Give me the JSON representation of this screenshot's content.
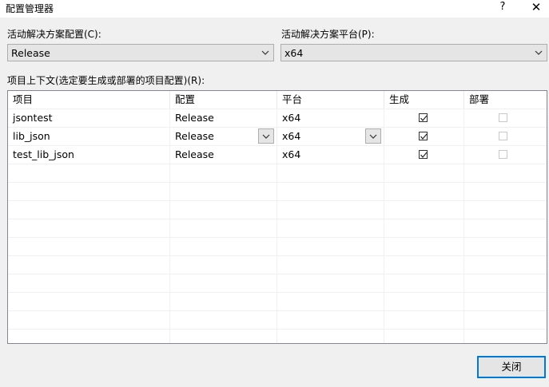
{
  "window": {
    "title": "配置管理器",
    "help_label": "?",
    "close_label": "✕"
  },
  "solution": {
    "config_label": "活动解决方案配置(C):",
    "config_value": "Release",
    "platform_label": "活动解决方案平台(P):",
    "platform_value": "x64"
  },
  "grid": {
    "label": "项目上下文(选定要生成或部署的项目配置)(R):",
    "headers": [
      "项目",
      "配置",
      "平台",
      "生成",
      "部署"
    ],
    "rows": [
      {
        "project": "jsontest",
        "config": "Release",
        "platform": "x64",
        "build": true,
        "deploy": false
      },
      {
        "project": "lib_json",
        "config": "Release",
        "platform": "x64",
        "build": true,
        "deploy": false
      },
      {
        "project": "test_lib_json",
        "config": "Release",
        "platform": "x64",
        "build": true,
        "deploy": false
      }
    ]
  },
  "footer": {
    "close_button": "关闭"
  },
  "icons": {
    "dropdown": "chevron-down-icon",
    "check": "checkmark-icon"
  }
}
